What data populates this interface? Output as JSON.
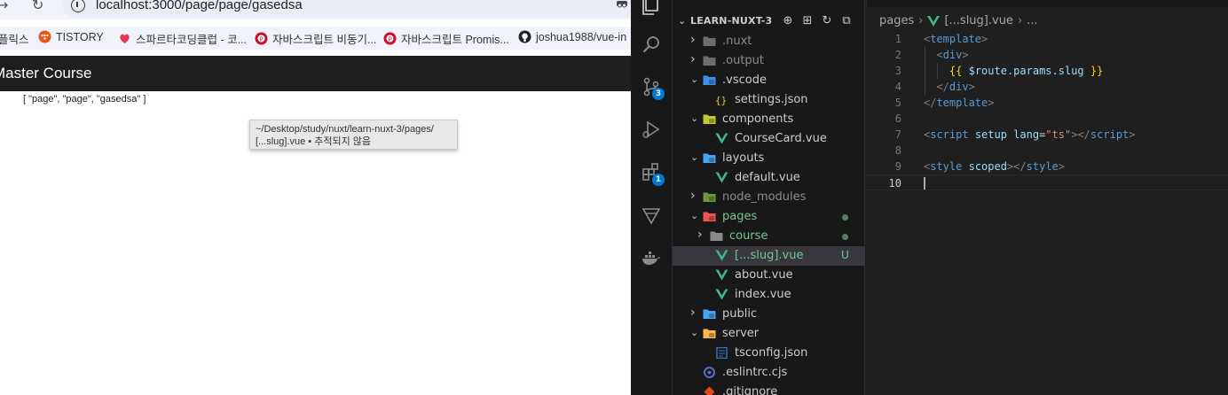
{
  "browser": {
    "url": "localhost:3000/page/page/gasedsa",
    "bookmarks": [
      {
        "label": "플릭스",
        "icon": "none"
      },
      {
        "label": "TISTORY",
        "icon": "tistory-icon",
        "color": "#eb531f"
      },
      {
        "label": "스파르타코딩클럽 - 코...",
        "icon": "sparta-icon",
        "color": "#e8344e"
      },
      {
        "label": "자바스크립트 비동기...",
        "icon": "site-icon",
        "color": "#c8102e"
      },
      {
        "label": "자바스크립트 Promis...",
        "icon": "site-icon",
        "color": "#c8102e"
      },
      {
        "label": "joshua1988/vue-in",
        "icon": "github-icon",
        "color": "#222222"
      }
    ],
    "app_title": "Master Course",
    "slug_output": "[ \"page\", \"page\", \"gasedsa\" ]",
    "tooltip": {
      "line1": "~/Desktop/study/nuxt/learn-nuxt-3/pages/",
      "line2": "[...slug].vue • 추적되지 않음"
    }
  },
  "vscode": {
    "activity": [
      {
        "name": "explorer-icon",
        "badge": ""
      },
      {
        "name": "search-icon",
        "badge": ""
      },
      {
        "name": "source-control-icon",
        "badge": "3"
      },
      {
        "name": "run-debug-icon",
        "badge": ""
      },
      {
        "name": "extensions-icon",
        "badge": "1"
      },
      {
        "name": "testing-icon",
        "badge": ""
      },
      {
        "name": "docker-icon",
        "badge": ""
      }
    ],
    "explorer": {
      "workspace": "LEARN-NUXT-3",
      "items": [
        {
          "label": ".nuxt",
          "type": "folder",
          "depth": 0,
          "open": false,
          "icon": "folder-icon",
          "color": "#8a8a8a",
          "dim": true,
          "status": ""
        },
        {
          "label": ".output",
          "type": "folder",
          "depth": 0,
          "open": false,
          "icon": "folder-icon",
          "color": "#8a8a8a",
          "dim": true,
          "status": ""
        },
        {
          "label": ".vscode",
          "type": "folder",
          "depth": 0,
          "open": true,
          "icon": "vscode-folder-icon",
          "color": "#3b8eea",
          "dim": false,
          "status": ""
        },
        {
          "label": "settings.json",
          "type": "file",
          "depth": 1,
          "icon": "json-icon",
          "color": "#e8c547",
          "dim": false,
          "status": ""
        },
        {
          "label": "components",
          "type": "folder",
          "depth": 0,
          "open": true,
          "icon": "components-folder-icon",
          "color": "#c0ca33",
          "dim": false,
          "status": ""
        },
        {
          "label": "CourseCard.vue",
          "type": "file",
          "depth": 1,
          "icon": "vue-icon",
          "color": "#41b883",
          "dim": false,
          "status": ""
        },
        {
          "label": "layouts",
          "type": "folder",
          "depth": 0,
          "open": true,
          "icon": "layouts-folder-icon",
          "color": "#42a5f5",
          "dim": false,
          "status": ""
        },
        {
          "label": "default.vue",
          "type": "file",
          "depth": 1,
          "icon": "vue-icon",
          "color": "#41b883",
          "dim": false,
          "status": ""
        },
        {
          "label": "node_modules",
          "type": "folder",
          "depth": 0,
          "open": false,
          "icon": "node-folder-icon",
          "color": "#8bc34a",
          "dim": true,
          "status": ""
        },
        {
          "label": "pages",
          "type": "folder",
          "depth": 0,
          "open": true,
          "icon": "pages-folder-icon",
          "color": "#ef5350",
          "dim": false,
          "status": "dot",
          "labelColor": "#73c991"
        },
        {
          "label": "course",
          "type": "folder",
          "depth": 1,
          "open": false,
          "icon": "folder-icon",
          "color": "#8a8a8a",
          "dim": false,
          "status": "dot",
          "labelColor": "#73c991"
        },
        {
          "label": "[...slug].vue",
          "type": "file",
          "depth": 1,
          "icon": "vue-icon",
          "color": "#41b883",
          "dim": false,
          "status": "U",
          "labelColor": "#73c991",
          "selected": true
        },
        {
          "label": "about.vue",
          "type": "file",
          "depth": 1,
          "icon": "vue-icon",
          "color": "#41b883",
          "dim": false,
          "status": ""
        },
        {
          "label": "index.vue",
          "type": "file",
          "depth": 1,
          "icon": "vue-icon",
          "color": "#41b883",
          "dim": false,
          "status": ""
        },
        {
          "label": "public",
          "type": "folder",
          "depth": 0,
          "open": false,
          "icon": "public-folder-icon",
          "color": "#42a5f5",
          "dim": false,
          "status": ""
        },
        {
          "label": "server",
          "type": "folder",
          "depth": 0,
          "open": true,
          "icon": "server-folder-icon",
          "color": "#ffb74d",
          "dim": false,
          "status": ""
        },
        {
          "label": "tsconfig.json",
          "type": "file",
          "depth": 1,
          "icon": "tsconfig-icon",
          "color": "#3178c6",
          "dim": false,
          "status": ""
        },
        {
          "label": ".eslintrc.cjs",
          "type": "file",
          "depth": 0,
          "icon": "eslint-icon",
          "color": "#5c6bc0",
          "dim": false,
          "status": ""
        },
        {
          "label": ".gitignore",
          "type": "file",
          "depth": 0,
          "icon": "git-icon",
          "color": "#e64a19",
          "dim": false,
          "status": ""
        }
      ]
    },
    "breadcrumb": [
      "pages",
      "[...slug].vue",
      "..."
    ],
    "code": [
      [
        [
          "br",
          "<"
        ],
        [
          "tag",
          "template"
        ],
        [
          "br",
          ">"
        ]
      ],
      [
        [
          "plain",
          "  "
        ],
        [
          "br",
          "<"
        ],
        [
          "tag",
          "div"
        ],
        [
          "br",
          ">"
        ]
      ],
      [
        [
          "plain",
          "    "
        ],
        [
          "mus",
          "{{ "
        ],
        [
          "var",
          "$route.params.slug"
        ],
        [
          "mus",
          " }}"
        ]
      ],
      [
        [
          "plain",
          "  "
        ],
        [
          "br",
          "</"
        ],
        [
          "tag",
          "div"
        ],
        [
          "br",
          ">"
        ]
      ],
      [
        [
          "br",
          "</"
        ],
        [
          "tag",
          "template"
        ],
        [
          "br",
          ">"
        ]
      ],
      [],
      [
        [
          "br",
          "<"
        ],
        [
          "tag",
          "script"
        ],
        [
          "plain",
          " "
        ],
        [
          "attr",
          "setup"
        ],
        [
          "plain",
          " "
        ],
        [
          "attr",
          "lang"
        ],
        [
          "plain",
          "="
        ],
        [
          "str",
          "\"ts\""
        ],
        [
          "br",
          "></"
        ],
        [
          "tag",
          "script"
        ],
        [
          "br",
          ">"
        ]
      ],
      [],
      [
        [
          "br",
          "<"
        ],
        [
          "tag",
          "style"
        ],
        [
          "plain",
          " "
        ],
        [
          "attr",
          "scoped"
        ],
        [
          "br",
          "></"
        ],
        [
          "tag",
          "style"
        ],
        [
          "br",
          ">"
        ]
      ],
      []
    ],
    "active_line": 10,
    "colors": {
      "accent": "#0078d4",
      "git_untracked": "#73c991"
    }
  }
}
